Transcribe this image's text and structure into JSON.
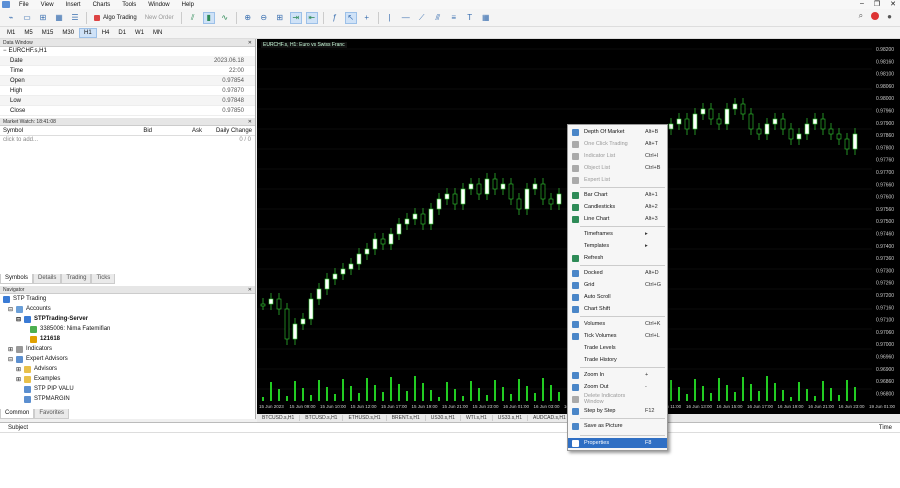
{
  "menubar": {
    "items": [
      "File",
      "View",
      "Insert",
      "Charts",
      "Tools",
      "Window",
      "Help"
    ]
  },
  "toolbar": {
    "algo_label": "Algo Trading",
    "new_order_label": "New Order"
  },
  "timeframes": [
    "M1",
    "M5",
    "M15",
    "M30",
    "H1",
    "H4",
    "D1",
    "W1",
    "MN"
  ],
  "data_window": {
    "title": "Data Window",
    "symbol": "EURCHF.s,H1",
    "rows": [
      {
        "k": "Date",
        "v": "2023.06.18"
      },
      {
        "k": "Time",
        "v": "22:00"
      },
      {
        "k": "Open",
        "v": "0.97854"
      },
      {
        "k": "High",
        "v": "0.97870"
      },
      {
        "k": "Low",
        "v": "0.97848"
      },
      {
        "k": "Close",
        "v": "0.97850"
      }
    ]
  },
  "market_watch": {
    "title": "Market Watch: 18:41:08",
    "headers": [
      "Symbol",
      "Bid",
      "Ask",
      "Daily Change"
    ],
    "click_to_add": "click to add...",
    "count": "0 / 0",
    "tabs": [
      "Symbols",
      "Details",
      "Trading",
      "Ticks"
    ]
  },
  "navigator": {
    "title": "Navigator",
    "items": [
      "STP Trading",
      "Accounts",
      "STPTrading-Server",
      "3385006: Nima Fatemifian",
      "121618",
      "Indicators",
      "Expert Advisors",
      "Advisors",
      "Examples",
      "STP PIP VALU",
      "STPMARGIN"
    ],
    "tabs": [
      "Common",
      "Favorites"
    ]
  },
  "chart": {
    "title": "EURCHF.s, H1: Euro vs Swiss Franc",
    "price_labels": [
      "0.98200",
      "0.98160",
      "0.98100",
      "0.98060",
      "0.98000",
      "0.97960",
      "0.97900",
      "0.97860",
      "0.97800",
      "0.97760",
      "0.97700",
      "0.97660",
      "0.97600",
      "0.97560",
      "0.97500",
      "0.97460",
      "0.97400",
      "0.97360",
      "0.97300",
      "0.97260",
      "0.97200",
      "0.97160",
      "0.97100",
      "0.97060",
      "0.97000",
      "0.96960",
      "0.96900",
      "0.96860",
      "0.96800"
    ],
    "time_labels": [
      "15 Jun 2023",
      "15 Jun 09:00",
      "15 Jun 10:00",
      "15 Jun 12:00",
      "15 Jun 17:00",
      "15 Jun 19:00",
      "15 Jun 21:00",
      "15 Jun 23:00",
      "16 Jun 01:00",
      "16 Jun 03:00",
      "16 Jun 05:00",
      "16 Jun 07:00",
      "16 Jun 09:00",
      "16 Jun 11:00",
      "16 Jun 13:00",
      "16 Jun 15:00",
      "16 Jun 17:00",
      "16 Jun 19:00",
      "16 Jun 21:00",
      "16 Jun 23:00",
      "19 Jun 01:00"
    ]
  },
  "doc_tabs": [
    "BTCUSD.s,H1",
    "BTCUSD.s,H1",
    "ETHUSD.s,H1",
    "BRENT.s,H1",
    "US30.s,H1",
    "WTI.s,H1",
    "US33.s,H1",
    "AUDCAD.s,H1"
  ],
  "bottom": {
    "subject": "Subject",
    "time": "Time"
  },
  "context_menu": {
    "items": [
      {
        "label": "Depth Of Market",
        "shortcut": "Alt+B",
        "disabled": false
      },
      {
        "label": "One Click Trading",
        "shortcut": "Alt+T",
        "disabled": true
      },
      {
        "label": "Indicator List",
        "shortcut": "Ctrl+I",
        "disabled": true
      },
      {
        "label": "Object List",
        "shortcut": "Ctrl+B",
        "disabled": true
      },
      {
        "label": "Expert List",
        "shortcut": "",
        "disabled": true
      },
      {
        "label": "Bar Chart",
        "shortcut": "Alt+1",
        "disabled": false
      },
      {
        "label": "Candlesticks",
        "shortcut": "Alt+2",
        "disabled": false
      },
      {
        "label": "Line Chart",
        "shortcut": "Alt+3",
        "disabled": false
      },
      {
        "label": "Timeframes",
        "shortcut": "▸",
        "disabled": false
      },
      {
        "label": "Templates",
        "shortcut": "▸",
        "disabled": false
      },
      {
        "label": "Refresh",
        "shortcut": "",
        "disabled": false
      },
      {
        "label": "Docked",
        "shortcut": "Alt+D",
        "disabled": false
      },
      {
        "label": "Grid",
        "shortcut": "Ctrl+G",
        "disabled": false
      },
      {
        "label": "Auto Scroll",
        "shortcut": "",
        "disabled": false
      },
      {
        "label": "Chart Shift",
        "shortcut": "",
        "disabled": false
      },
      {
        "label": "Volumes",
        "shortcut": "Ctrl+K",
        "disabled": false
      },
      {
        "label": "Tick Volumes",
        "shortcut": "Ctrl+L",
        "disabled": false
      },
      {
        "label": "Trade Levels",
        "shortcut": "",
        "disabled": false
      },
      {
        "label": "Trade History",
        "shortcut": "",
        "disabled": false
      },
      {
        "label": "Zoom In",
        "shortcut": "+",
        "disabled": false
      },
      {
        "label": "Zoom Out",
        "shortcut": "-",
        "disabled": false
      },
      {
        "label": "Delete Indicators Window",
        "shortcut": "",
        "disabled": true
      },
      {
        "label": "Step by Step",
        "shortcut": "F12",
        "disabled": false
      },
      {
        "label": "Save as Picture",
        "shortcut": "",
        "disabled": false
      },
      {
        "label": "Properties",
        "shortcut": "F8",
        "disabled": false
      }
    ]
  }
}
